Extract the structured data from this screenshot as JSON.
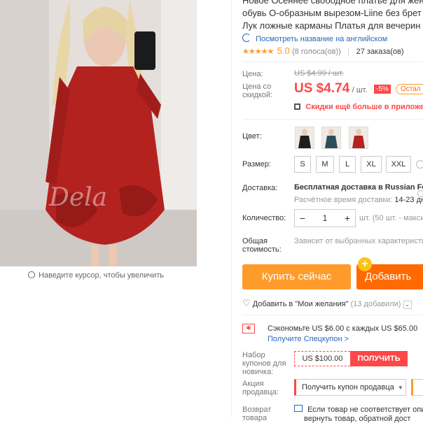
{
  "gallery": {
    "hover_hint": "Наведите курсор, чтобы увеличить",
    "watermark": "Dela"
  },
  "product": {
    "title_lines": [
      "Новое Осеннее свободное платье для жен",
      "обувь О-образным вырезом-Liine без брет",
      "Лук ложные карманы Платья для вечерин"
    ],
    "translate_link": "Посмотреть название на английском",
    "rating": "5.0",
    "votes": "(8 голоса(ов))",
    "orders": "27 заказа(ов)"
  },
  "price": {
    "label": "Цена:",
    "old": "US $4.99 / шт.",
    "discount_label": "Цена со скидкой:",
    "current": "US $4.74",
    "unit": "/ шт.",
    "badge": "-5%",
    "remaining": "Остал",
    "app_promo": "Скидки ещё больше в приложени"
  },
  "options": {
    "color_label": "Цвет:",
    "size_label": "Размер:",
    "sizes": [
      "S",
      "M",
      "L",
      "XL",
      "XXL"
    ]
  },
  "shipping": {
    "label": "Доставка:",
    "value": "Бесплатная доставка в Russian Fed",
    "time_label": "Расчётное время доставки:",
    "time_value": "14-23 дн"
  },
  "quantity": {
    "label": "Количество:",
    "minus": "−",
    "value": "1",
    "plus": "+",
    "stock": "шт. (50 шт. - макси"
  },
  "total": {
    "label_line1": "Общая",
    "label_line2": "стоимость:",
    "value": "Зависит от выбранных характеристи"
  },
  "actions": {
    "buy_now": "Купить сейчас",
    "add_to_cart": "Добавить",
    "wishlist": "Добавить в \"Мои желания\"",
    "wishlist_count": "(13 добавили)"
  },
  "coupons": {
    "save_text": "Сэкономьте US $6.00 с каждых US $65.00",
    "get_coupon_link": "Получите Спецкупон >",
    "newbie_label_1": "Набор",
    "newbie_label_2": "купонов для",
    "newbie_label_3": "новичка:",
    "newbie_value": "US $100.00",
    "newbie_button": "ПОЛУЧИТЬ",
    "seller_label_1": "Акция",
    "seller_label_2": "продавца:",
    "seller_select": "Получить купон продавца",
    "return_label_1": "Возврат",
    "return_label_2": "товара",
    "return_text": "Если товар не соответствует опис",
    "return_text_2": "вернуть товар, обратной дост"
  },
  "colors": {
    "accent": "#ff4747",
    "orange": "#ff9b2b",
    "dark_orange": "#ff6a00",
    "link": "#2a66b7",
    "dress": "#b3221f"
  }
}
